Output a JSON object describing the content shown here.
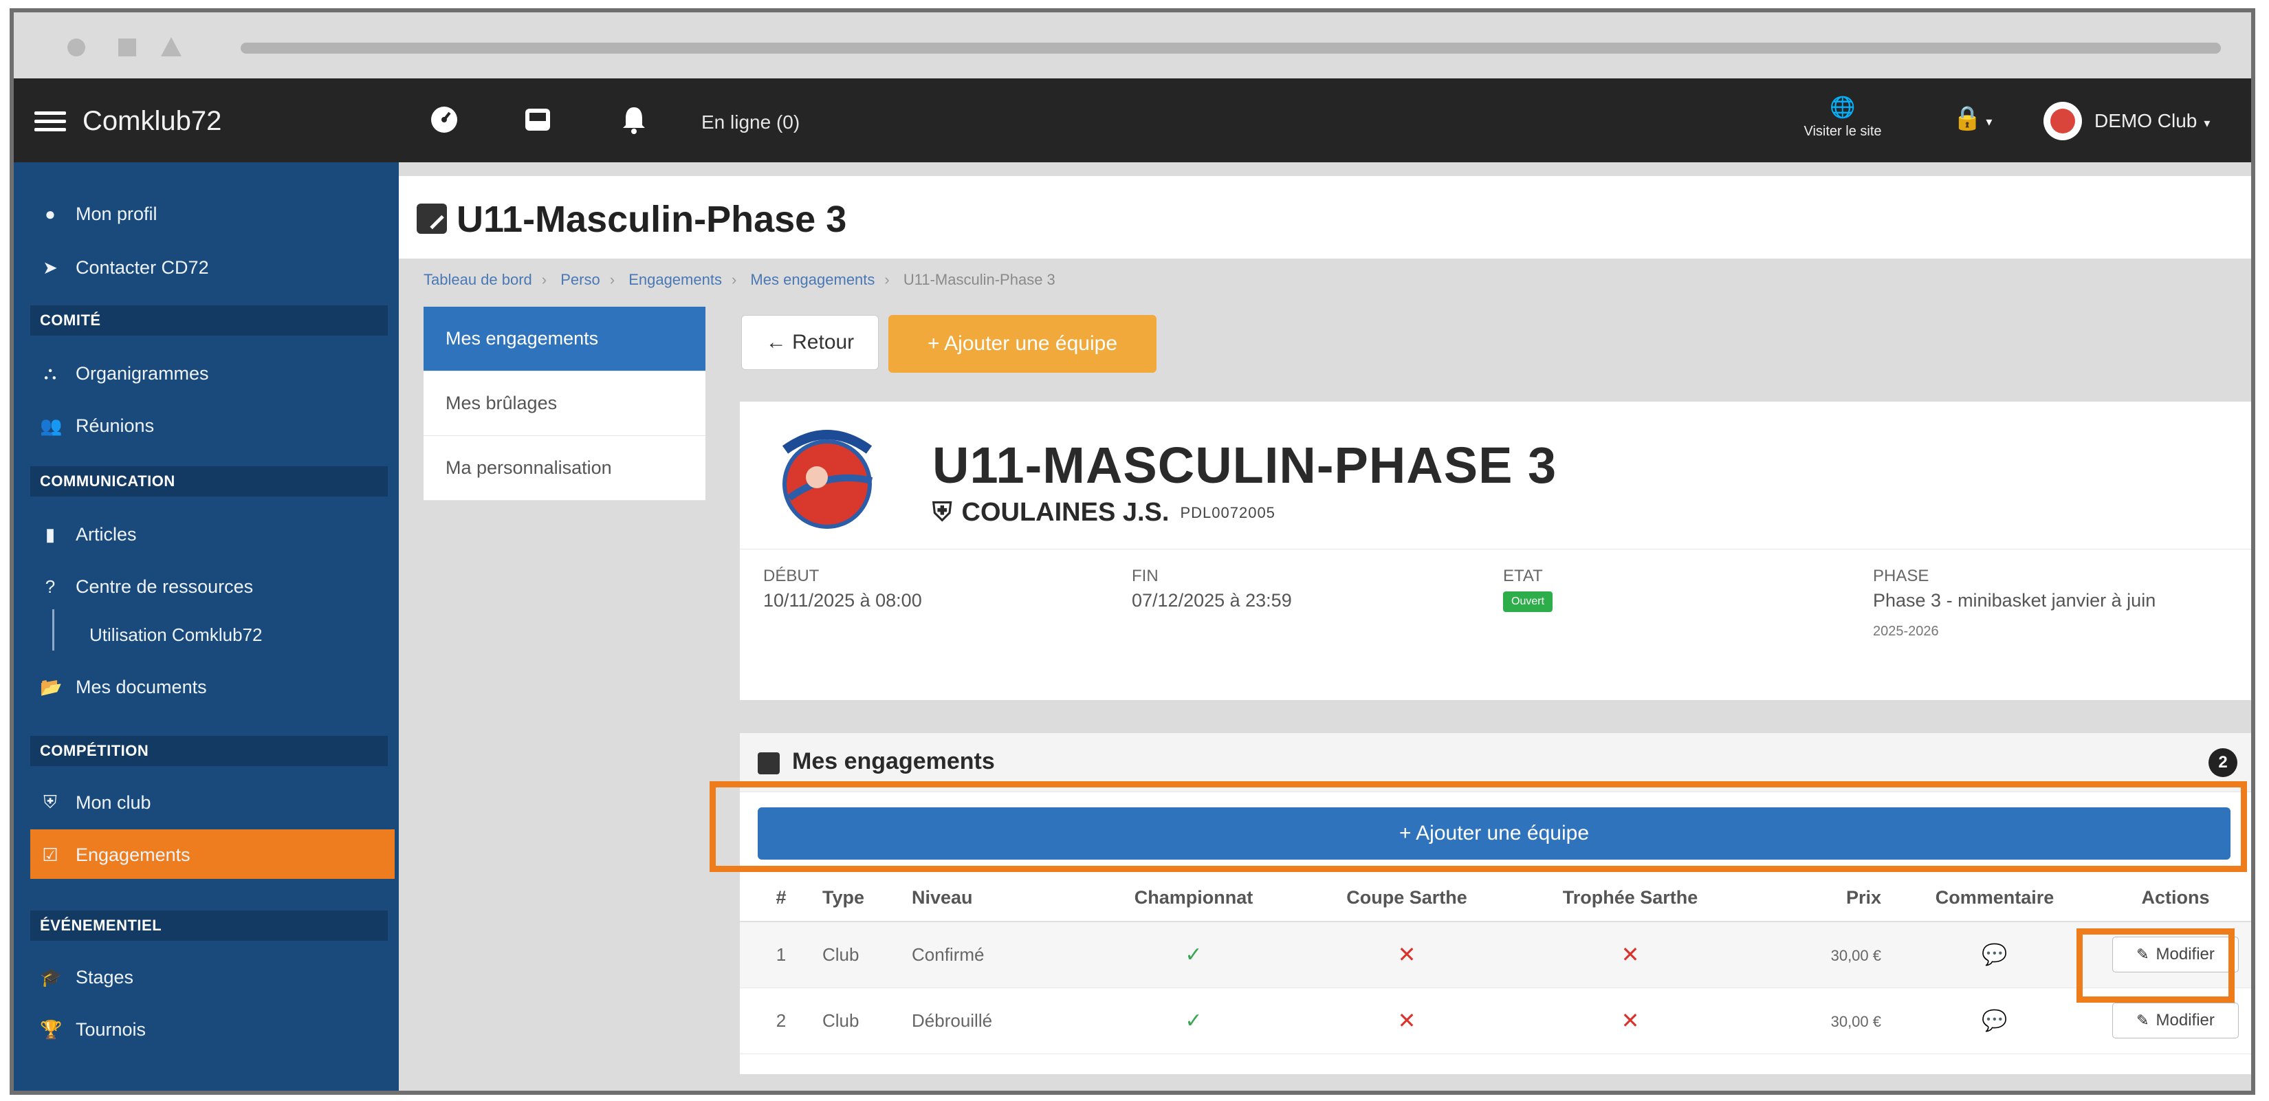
{
  "topnav": {
    "brand": "Comklub72",
    "online": "En ligne (0)",
    "visit": "Visiter le site",
    "club": "DEMO Club"
  },
  "sidebar": {
    "items": [
      {
        "label": "Mon profil",
        "icon": "user-circle-icon"
      },
      {
        "label": "Contacter CD72",
        "icon": "send-icon"
      }
    ],
    "section_comite": "COMITÉ",
    "comite_items": [
      {
        "label": "Organigrammes",
        "icon": "sitemap-icon"
      },
      {
        "label": "Réunions",
        "icon": "users-icon"
      }
    ],
    "section_communication": "COMMUNICATION",
    "communication_items": [
      {
        "label": "Articles",
        "icon": "bookmark-icon"
      },
      {
        "label": "Centre de ressources",
        "icon": "question-circle-icon"
      },
      {
        "label": "Utilisation Comklub72",
        "icon": ""
      },
      {
        "label": "Mes documents",
        "icon": "folder-open-icon"
      }
    ],
    "section_competition": "COMPÉTITION",
    "competition_items": [
      {
        "label": "Mon club",
        "icon": "shield-icon"
      },
      {
        "label": "Engagements",
        "icon": "edit-square-icon"
      }
    ],
    "section_evenementiel": "ÉVÉNEMENTIEL",
    "evenementiel_items": [
      {
        "label": "Stages",
        "icon": "graduation-cap-icon"
      },
      {
        "label": "Tournois",
        "icon": "trophy-icon"
      }
    ]
  },
  "page": {
    "title": "U11-Masculin-Phase 3",
    "breadcrumb": [
      "Tableau de bord",
      "Perso",
      "Engagements",
      "Mes engagements",
      "U11-Masculin-Phase 3"
    ]
  },
  "left_menu": [
    "Mes engagements",
    "Mes brûlages",
    "Ma personnalisation"
  ],
  "buttons": {
    "retour": "← Retour",
    "add_top": "+ Ajouter une équipe",
    "add_wide": "+ Ajouter une équipe",
    "modifier": "Modifier"
  },
  "card": {
    "title": "U11-MASCULIN-PHASE 3",
    "club": "COULAINES J.S.",
    "club_code": "PDL0072005",
    "debut_label": "DÉBUT",
    "debut_value": "10/11/2025 à 08:00",
    "fin_label": "FIN",
    "fin_value": "07/12/2025 à 23:59",
    "etat_label": "ETAT",
    "etat_value": "Ouvert",
    "phase_label": "PHASE",
    "phase_value": "Phase 3 - minibasket janvier à juin",
    "phase_season": "2025-2026"
  },
  "panel": {
    "title": "Mes engagements",
    "count": "2"
  },
  "table": {
    "headers": [
      "#",
      "Type",
      "Niveau",
      "Championnat",
      "Coupe Sarthe",
      "Trophée Sarthe",
      "Prix",
      "Commentaire",
      "Actions"
    ],
    "rows": [
      {
        "num": "1",
        "type": "Club",
        "niveau": "Confirmé",
        "prix": "30,00 €"
      },
      {
        "num": "2",
        "type": "Club",
        "niveau": "Débrouillé",
        "prix": "30,00 €"
      }
    ]
  },
  "colors": {
    "sidebar_bg": "#1a4a7c",
    "accent_orange": "#ee7d1f",
    "primary_blue": "#2f73bd",
    "topnav_bg": "#252525"
  }
}
